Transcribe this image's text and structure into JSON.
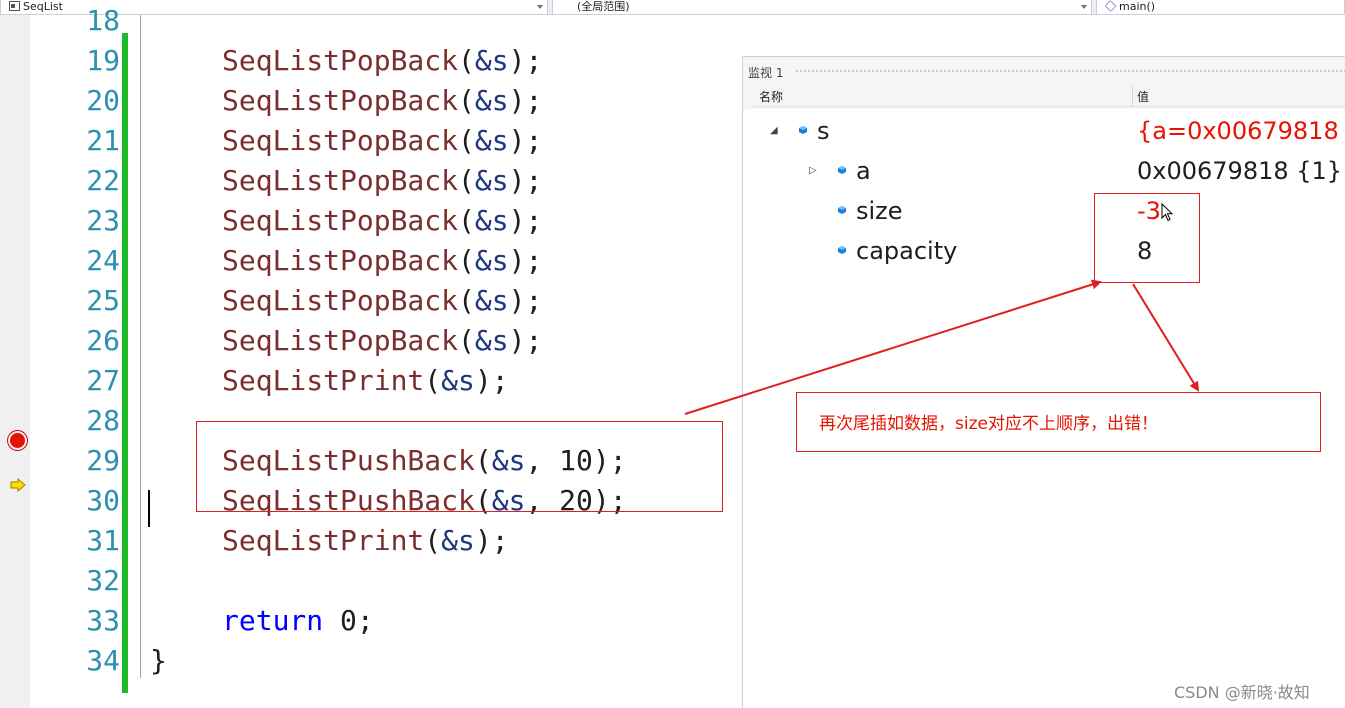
{
  "navbar": {
    "project": "SeqList",
    "scope": "(全局范围)",
    "function": "main()"
  },
  "editor": {
    "lines": [
      {
        "number": "18",
        "partial": true
      },
      {
        "number": "19",
        "fn": "SeqListPopBack",
        "args": [
          "&s"
        ],
        "end": ");"
      },
      {
        "number": "20",
        "fn": "SeqListPopBack",
        "args": [
          "&s"
        ],
        "end": ");"
      },
      {
        "number": "21",
        "fn": "SeqListPopBack",
        "args": [
          "&s"
        ],
        "end": ");"
      },
      {
        "number": "22",
        "fn": "SeqListPopBack",
        "args": [
          "&s"
        ],
        "end": ");"
      },
      {
        "number": "23",
        "fn": "SeqListPopBack",
        "args": [
          "&s"
        ],
        "end": ");"
      },
      {
        "number": "24",
        "fn": "SeqListPopBack",
        "args": [
          "&s"
        ],
        "end": ");"
      },
      {
        "number": "25",
        "fn": "SeqListPopBack",
        "args": [
          "&s"
        ],
        "end": ");"
      },
      {
        "number": "26",
        "fn": "SeqListPopBack",
        "args": [
          "&s"
        ],
        "end": ");"
      },
      {
        "number": "27",
        "fn": "SeqListPrint",
        "args": [
          "&s"
        ],
        "end": ");"
      },
      {
        "number": "28"
      },
      {
        "number": "29",
        "fn": "SeqListPushBack",
        "args": [
          "&s",
          "10"
        ],
        "end": ");",
        "breakpoint": true
      },
      {
        "number": "30",
        "fn": "SeqListPushBack",
        "args": [
          "&s",
          "20"
        ],
        "end": ");",
        "current": true
      },
      {
        "number": "31",
        "fn": "SeqListPrint",
        "args": [
          "&s"
        ],
        "end": ");"
      },
      {
        "number": "32"
      },
      {
        "number": "33",
        "keyword": "return",
        "value": "0",
        "end": ";"
      },
      {
        "number": "34",
        "brace": "}"
      }
    ]
  },
  "watch": {
    "title": "监视 1",
    "col_name": "名称",
    "col_value": "值",
    "rows": [
      {
        "name": "s",
        "value": "{a=0x00679818 {",
        "expanded": true,
        "changed": true
      },
      {
        "name": "a",
        "value": "0x00679818 {1}",
        "expandable": true
      },
      {
        "name": "size",
        "value": "-3",
        "changed": true
      },
      {
        "name": "capacity",
        "value": "8"
      }
    ]
  },
  "annotation": {
    "text": "再次尾插如数据，size对应不上顺序，出错！"
  },
  "watermark": "CSDN @新晓·故知",
  "colors": {
    "accent_red": "#e02020",
    "changed_value": "#e51400",
    "line_number": "#2b91af",
    "keyword": "#0000ff",
    "green_change_bar": "#1fba2a"
  }
}
